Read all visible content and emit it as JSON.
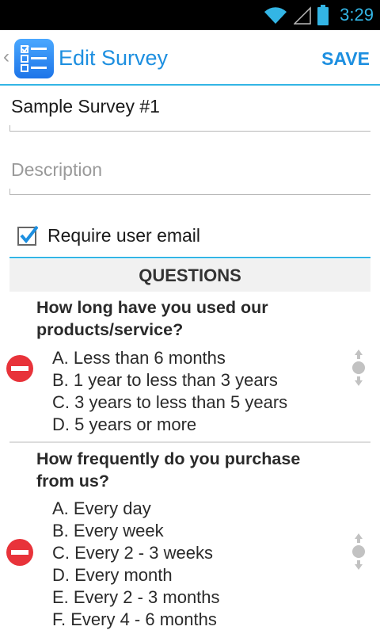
{
  "status_bar": {
    "time": "3:29"
  },
  "action_bar": {
    "title": "Edit Survey",
    "save_label": "SAVE"
  },
  "survey": {
    "name_value": "Sample Survey #1",
    "description_placeholder": "Description"
  },
  "require_email": {
    "label": "Require user email",
    "checked": true
  },
  "questions_header": "QUESTIONS",
  "questions": [
    {
      "title": "How long have you used our products/service?",
      "options": [
        "A. Less than 6 months",
        "B. 1 year to less than 3 years",
        "C. 3 years to less than 5 years",
        "D. 5 years or more"
      ]
    },
    {
      "title": "How frequently do you purchase from us?",
      "options": [
        "A. Every day",
        "B. Every week",
        "C. Every 2 - 3 weeks",
        "D. Every month",
        "E. Every 2 - 3 months",
        "F. Every 4 - 6 months"
      ]
    }
  ],
  "colors": {
    "accent": "#33b5e5",
    "title_blue": "#1d8fe0",
    "remove_red": "#e8333a"
  }
}
